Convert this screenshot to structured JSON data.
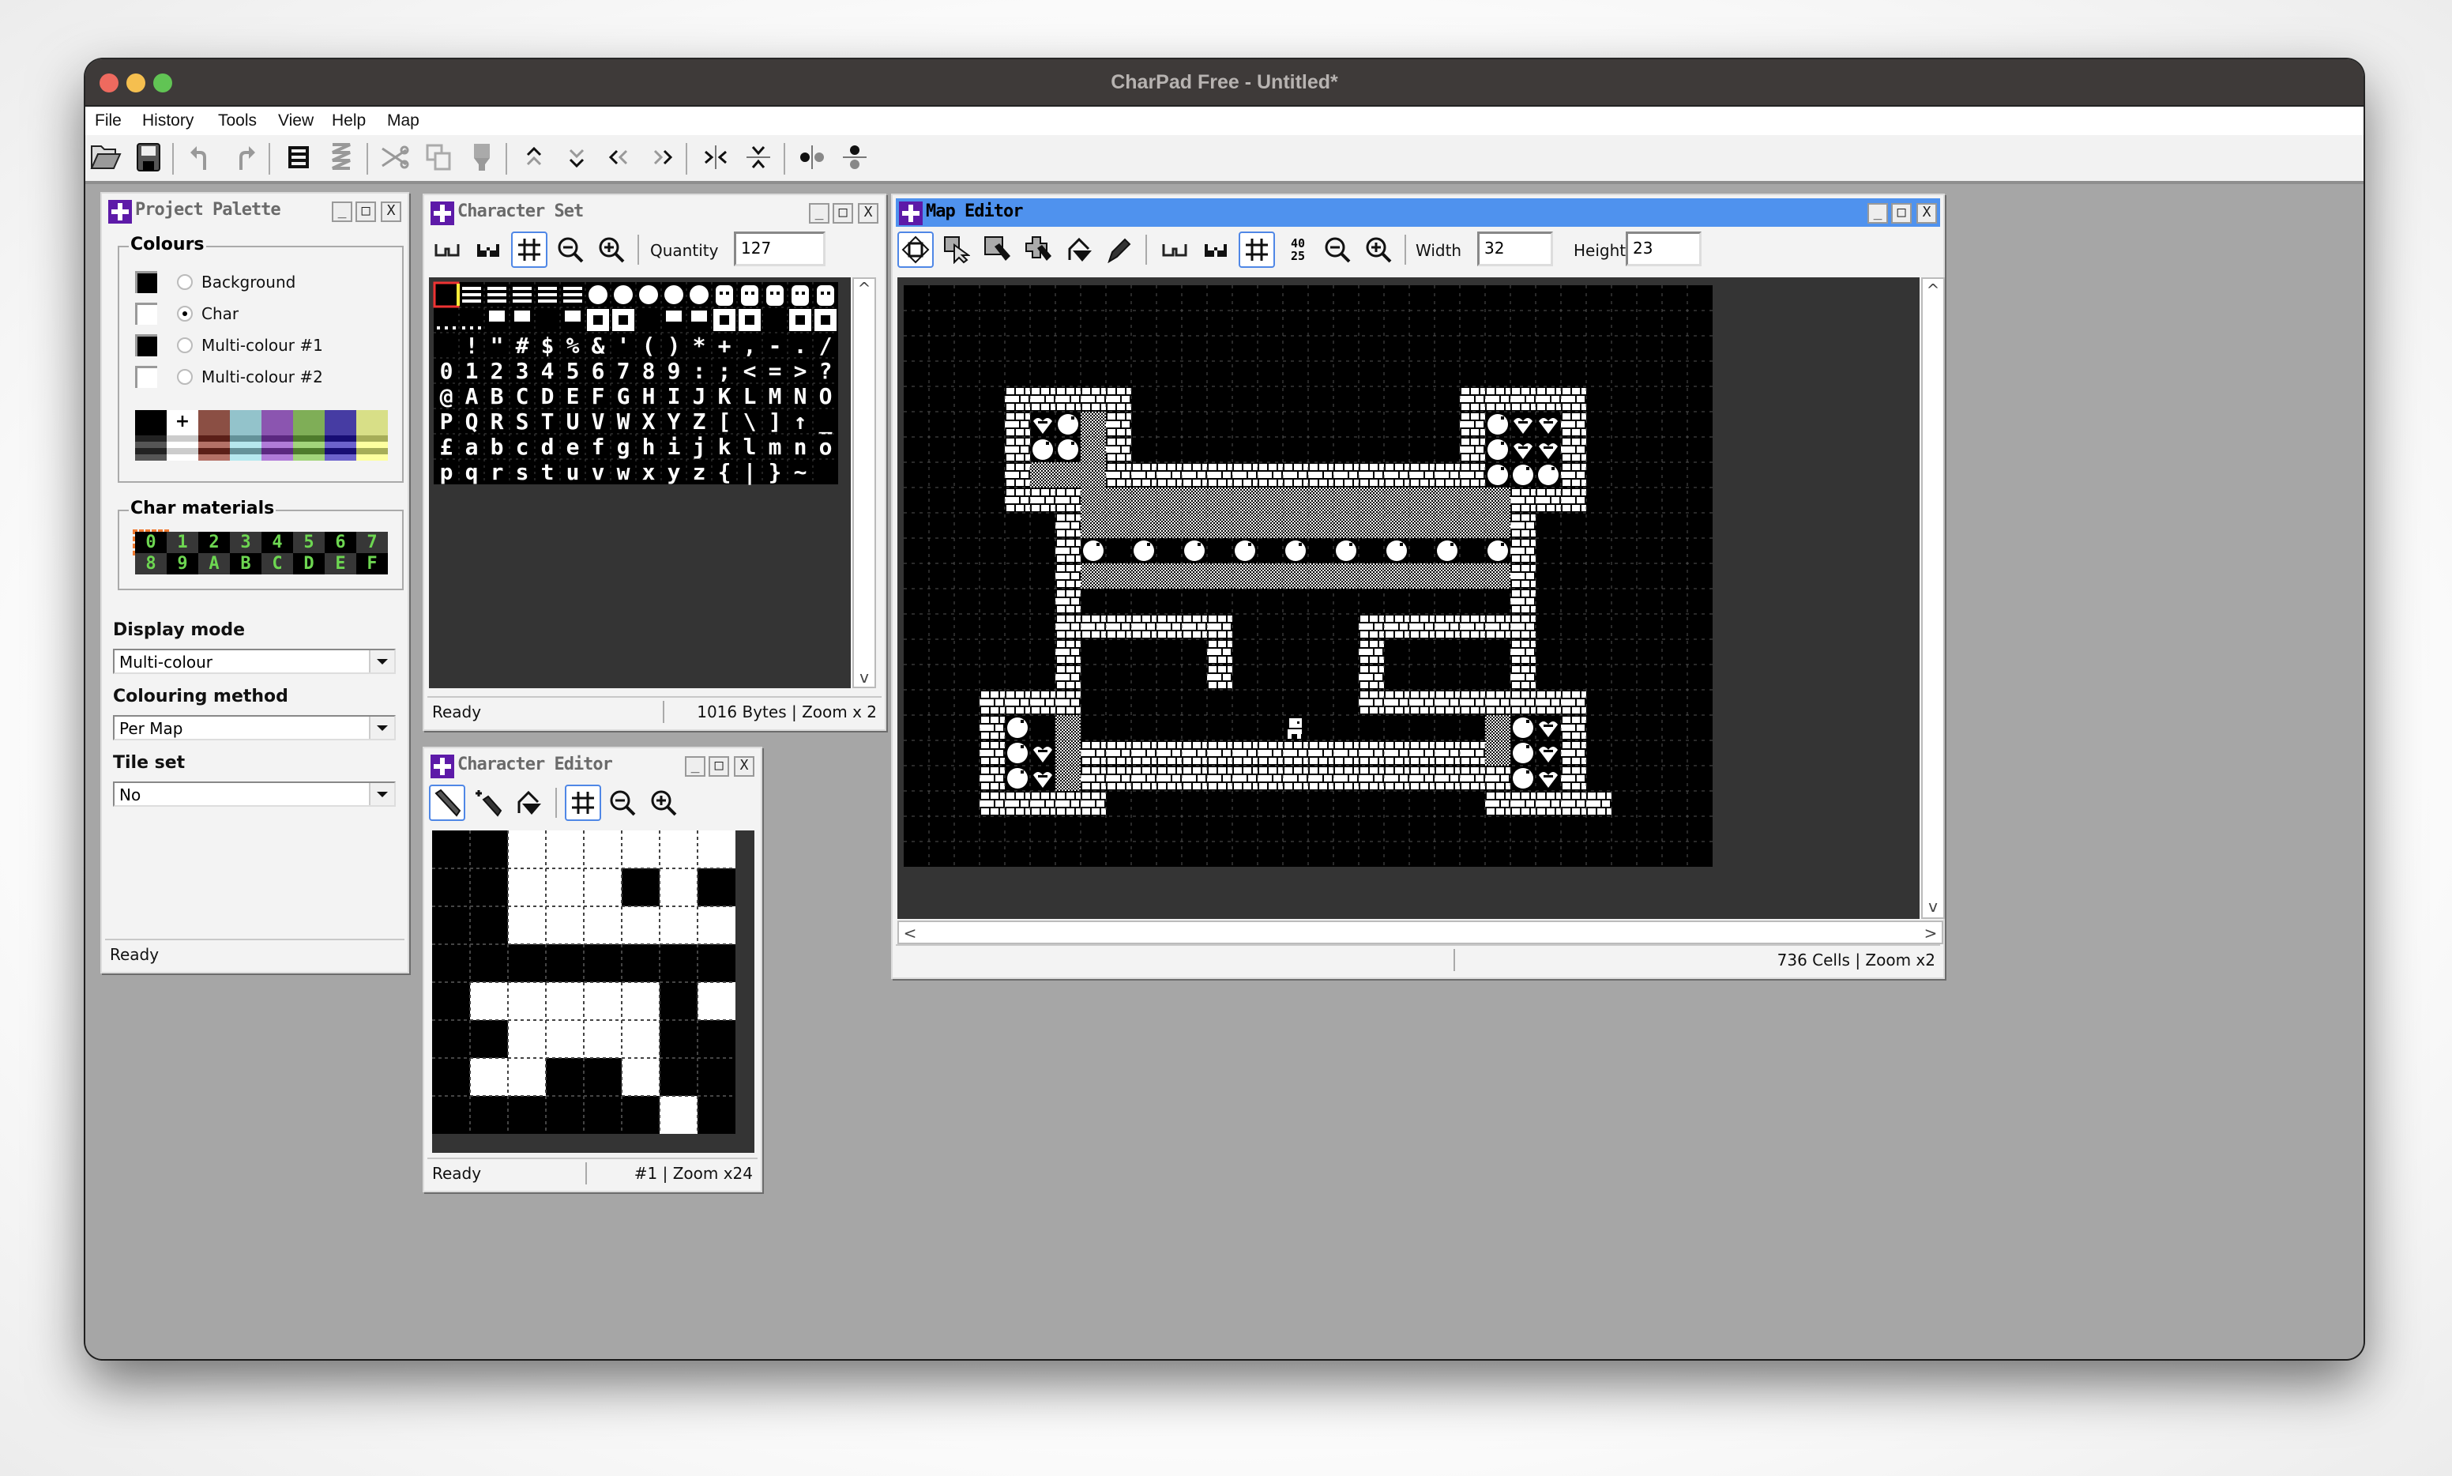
{
  "app": {
    "title": "CharPad Free - Untitled*",
    "menu": [
      "File",
      "History",
      "Tools",
      "View",
      "Help",
      "Map"
    ],
    "toolbar": [
      {
        "icon": "open-folder-icon",
        "label": "Open"
      },
      {
        "icon": "save-icon",
        "label": "Save"
      },
      {
        "icon": "undo-icon",
        "label": "Undo"
      },
      {
        "icon": "redo-icon",
        "label": "Redo"
      },
      {
        "icon": "compress-icon",
        "label": "Compress"
      },
      {
        "icon": "decompress-icon",
        "label": "Decompress"
      },
      {
        "icon": "cut-icon",
        "label": "Cut"
      },
      {
        "icon": "copy-icon",
        "label": "Copy"
      },
      {
        "icon": "paste-icon",
        "label": "Paste"
      },
      {
        "icon": "shift-up-icon",
        "label": "Shift up"
      },
      {
        "icon": "shift-down-icon",
        "label": "Shift down"
      },
      {
        "icon": "shift-left-icon",
        "label": "Shift left"
      },
      {
        "icon": "shift-right-icon",
        "label": "Shift right"
      },
      {
        "icon": "flip-horizontal-icon",
        "label": "Flip horizontal"
      },
      {
        "icon": "flip-vertical-icon",
        "label": "Flip vertical"
      },
      {
        "icon": "mirror-horizontal-icon",
        "label": "Mirror horizontal"
      },
      {
        "icon": "mirror-vertical-icon",
        "label": "Mirror vertical"
      }
    ]
  },
  "project_palette": {
    "title": "Project Palette",
    "colours_label": "Colours",
    "colours": [
      {
        "label": "Background",
        "swatch": "#000000",
        "checked": false
      },
      {
        "label": "Char",
        "swatch": "#ffffff",
        "checked": true
      },
      {
        "label": "Multi-colour #1",
        "swatch": "#000000",
        "checked": false
      },
      {
        "label": "Multi-colour #2",
        "swatch": "#ffffff",
        "checked": false
      }
    ],
    "palette": [
      {
        "main": "#000000",
        "light": "#555555",
        "dark": "#222222",
        "marker": false
      },
      {
        "main": "#ffffff",
        "light": "#ffffff",
        "dark": "#cccccc",
        "marker": true
      },
      {
        "main": "#8b4f44",
        "light": "#b47167",
        "dark": "#5b1f18",
        "marker": false
      },
      {
        "main": "#93c3cb",
        "light": "#b5e8ee",
        "dark": "#649299",
        "marker": false
      },
      {
        "main": "#8b55b0",
        "light": "#b07bd8",
        "dark": "#5b2880",
        "marker": false
      },
      {
        "main": "#7fae57",
        "light": "#a2d47b",
        "dark": "#4e7b2c",
        "marker": false
      },
      {
        "main": "#463ca3",
        "light": "#6c62cc",
        "dark": "#170d74",
        "marker": false
      },
      {
        "main": "#d8df87",
        "light": "#fdff9f",
        "dark": "#a6ad58",
        "marker": false
      }
    ],
    "materials_label": "Char materials",
    "materials": [
      "0",
      "1",
      "2",
      "3",
      "4",
      "5",
      "6",
      "7",
      "8",
      "9",
      "A",
      "B",
      "C",
      "D",
      "E",
      "F"
    ],
    "selected_material": "0",
    "display_mode_label": "Display mode",
    "display_mode": "Multi-colour",
    "colouring_method_label": "Colouring method",
    "colouring_method": "Per Map",
    "tile_set_label": "Tile set",
    "tile_set": "No",
    "status": "Ready"
  },
  "character_set": {
    "title": "Character Set",
    "quantity_label": "Quantity",
    "quantity": "127",
    "tools": [
      "view-mode-icon",
      "view-mode-filled-icon",
      "grid-icon",
      "zoom-out-icon",
      "zoom-in-icon"
    ],
    "glyph_rows": [
      "",
      "",
      " !\"#$%&'()*+,-./",
      "0123456789:;<=>?",
      "@ABCDEFGHIJKLMNO",
      "PQRSTUVWXYZ[\\]↑_",
      "£abcdefghijklmno",
      "pqrstuvwxyz{|}~"
    ],
    "status": "Ready",
    "status_info": "1016 Bytes | Zoom x 2"
  },
  "character_editor": {
    "title": "Character Editor",
    "tools": [
      "pencil-icon",
      "add-pencil-icon",
      "fill-icon",
      "grid-icon",
      "zoom-out-icon",
      "zoom-in-icon"
    ],
    "pixels": [
      "00111111",
      "00111010",
      "00111111",
      "00000000",
      "01111101",
      "00111100",
      "01100100",
      "00000010"
    ],
    "status": "Ready",
    "status_info": "#1 | Zoom x24"
  },
  "map_editor": {
    "title": "Map Editor",
    "tools": [
      "move-icon",
      "select-icon",
      "stamp-icon",
      "multi-stamp-icon",
      "fill-icon",
      "eyedropper-icon",
      "view-mode-icon",
      "view-mode-filled-icon",
      "grid-icon",
      "screen-size-icon",
      "zoom-out-icon",
      "zoom-in-icon"
    ],
    "screen_size_label": "40 25",
    "width_label": "Width",
    "width": "32",
    "height_label": "Height",
    "height": "23",
    "status_info": "736 Cells | Zoom x2",
    "legend": {
      ".": "empty",
      "B": "brick",
      "H": "hatch",
      "O": "orb",
      "W": "heart",
      "P": "player"
    },
    "map": [
      "................................",
      "................................",
      "................................",
      "................................",
      "....BBBBB.............BBBBB.....",
      "....BWOHB.............BOWWB.....",
      "....BOOHB.............BOWWB.....",
      "....BHHHBBBBBBBBBBBBBBBOOOB.....",
      "....BBBHHHHHHHHHHHHHHHHHBBB.....",
      "......BHHHHHHHHHHHHHHHHHB.......",
      "......BO.O.O.O.O.O.O.O.OB.......",
      "......BHHHHHHHHHHHHHHHHHB.......",
      "......B.................B.......",
      "......BBBBBBB.....BBBBBBB.......",
      "......B.....B.....B.....B.......",
      "......B.....B.....B.....B.......",
      "...BBBB...........BBBBBBBBB.....",
      "...BO.H........P.......HOWB.....",
      "...BOWHBBBBBBBBBBBBBBBBHOWB.....",
      "...BOWHBBBBBBBBBBBBBBBBBOWB.....",
      "...BBBBB...............BBBBB....",
      "................................",
      "................................"
    ]
  }
}
